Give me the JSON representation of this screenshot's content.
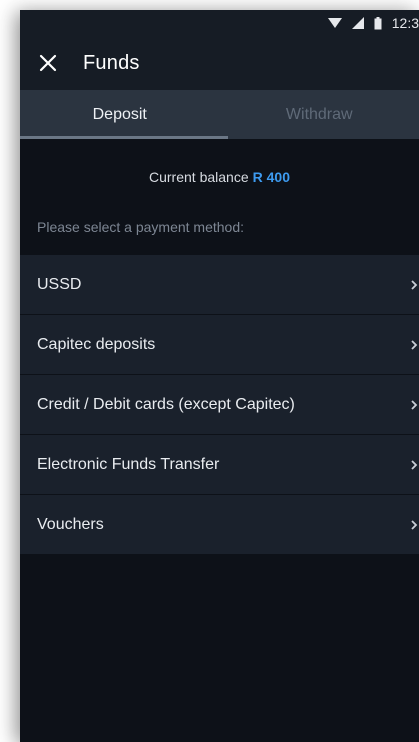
{
  "status_bar": {
    "time": "12:3",
    "icons": [
      "wifi-icon",
      "signal-icon",
      "battery-icon"
    ]
  },
  "header": {
    "close_icon": "close-icon",
    "title": "Funds"
  },
  "tabs": [
    {
      "label": "Deposit",
      "active": true
    },
    {
      "label": "Withdraw",
      "active": false
    }
  ],
  "balance": {
    "label": "Current balance",
    "amount": "R 400"
  },
  "select_prompt": "Please select a payment method:",
  "methods": [
    {
      "label": "USSD"
    },
    {
      "label": "Capitec deposits"
    },
    {
      "label": "Credit / Debit cards (except Capitec)"
    },
    {
      "label": "Electronic Funds Transfer"
    },
    {
      "label": "Vouchers"
    }
  ],
  "colors": {
    "background": "#0d1118",
    "accent": "#3d9bf0",
    "row": "#1a212c",
    "tabbar": "#2b3440"
  }
}
